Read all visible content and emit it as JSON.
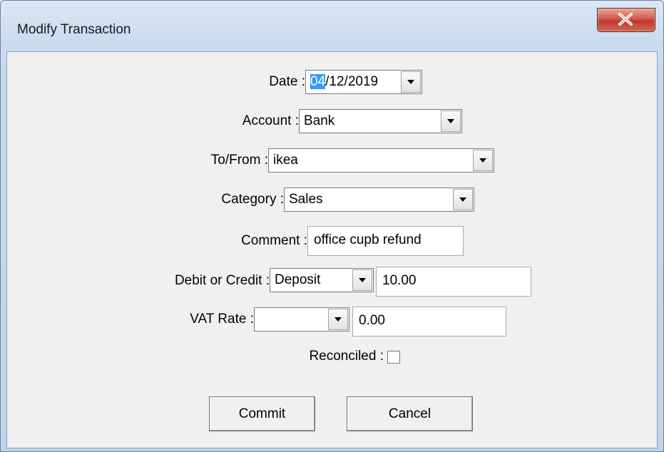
{
  "window": {
    "title": "Modify Transaction"
  },
  "form": {
    "date": {
      "label": "Date :",
      "value_selected": "04",
      "value_rest": "/12/2019"
    },
    "account": {
      "label": "Account :",
      "value": "Bank"
    },
    "to_from": {
      "label": "To/From :",
      "value": "ikea"
    },
    "category": {
      "label": "Category :",
      "value": "Sales"
    },
    "comment": {
      "label": "Comment :",
      "value": "office cupb refund"
    },
    "debit_credit": {
      "label": "Debit or Credit :",
      "type_value": "Deposit",
      "amount": "10.00"
    },
    "vat_rate": {
      "label": "VAT Rate :",
      "rate_value": "",
      "amount": "0.00"
    },
    "reconciled": {
      "label": "Reconciled :",
      "checked": false
    }
  },
  "buttons": {
    "commit": "Commit",
    "cancel": "Cancel"
  },
  "colors": {
    "selection": "#3399ff",
    "close_button": "#c0392b",
    "client_bg": "#f0f0f0"
  },
  "icons": {
    "close": "close-x-icon",
    "dropdown": "chevron-down-icon"
  }
}
